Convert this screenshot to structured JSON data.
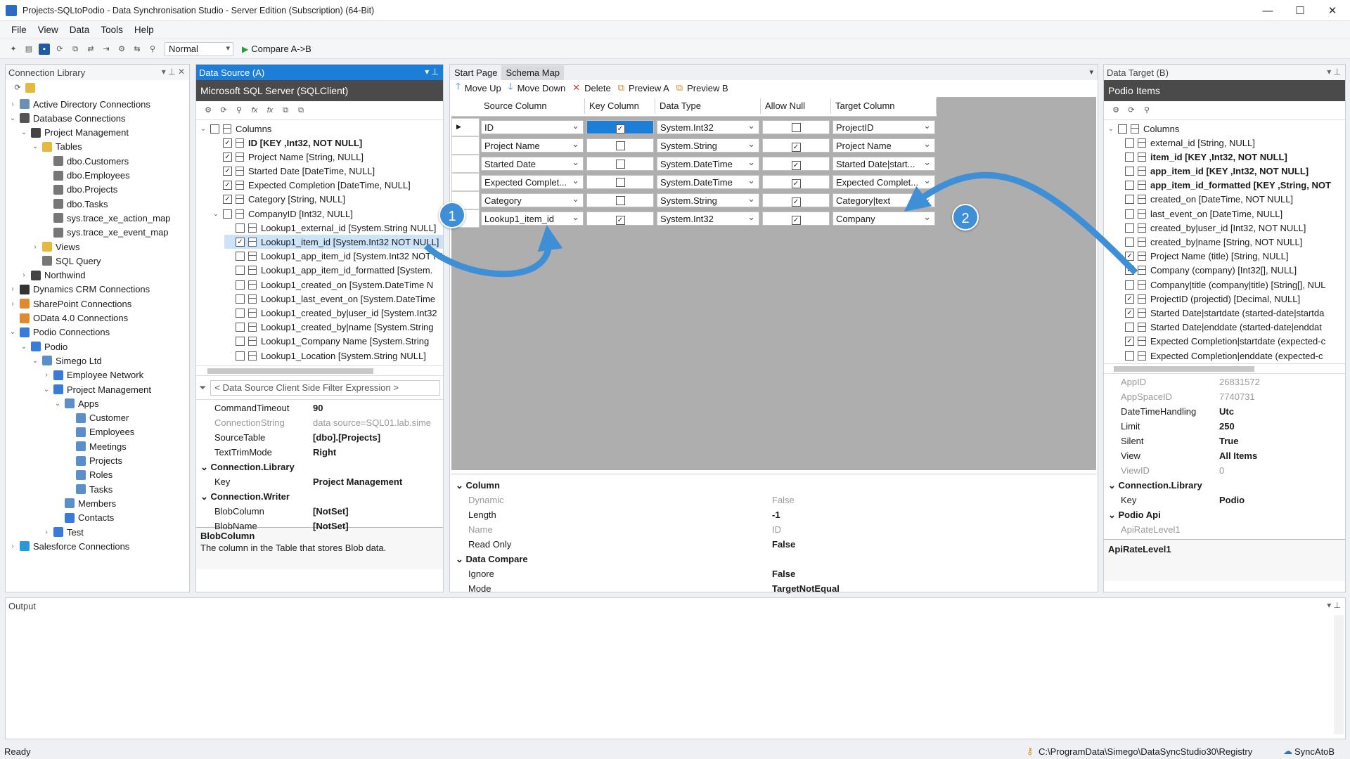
{
  "window": {
    "title": "Projects-SQLtoPodio - Data Synchronisation Studio - Server Edition (Subscription) (64-Bit)"
  },
  "menu": [
    "File",
    "View",
    "Data",
    "Tools",
    "Help"
  ],
  "toolbar": {
    "mode": "Normal",
    "compare": "Compare A->B"
  },
  "connection_library": {
    "title": "Connection Library",
    "items": [
      "Active Directory Connections",
      "Database Connections",
      "Project Management",
      "Tables",
      "dbo.Customers",
      "dbo.Employees",
      "dbo.Projects",
      "dbo.Tasks",
      "sys.trace_xe_action_map",
      "sys.trace_xe_event_map",
      "Views",
      "SQL Query",
      "Northwind",
      "Dynamics CRM Connections",
      "SharePoint Connections",
      "OData 4.0 Connections",
      "Podio Connections",
      "Podio",
      "Simego Ltd",
      "Employee Network",
      "Project Management",
      "Apps",
      "Customer",
      "Employees",
      "Meetings",
      "Projects",
      "Roles",
      "Tasks",
      "Members",
      "Contacts",
      "Test",
      "Salesforce Connections"
    ]
  },
  "source": {
    "title": "Data Source (A)",
    "provider": "Microsoft SQL Server (SQLClient)",
    "columns_label": "Columns",
    "columns": [
      "ID [KEY ,Int32, NOT NULL]",
      "Project Name [String, NULL]",
      "Started Date [DateTime, NULL]",
      "Expected Completion [DateTime, NULL]",
      "Category [String, NULL]",
      "CompanyID [Int32, NULL]",
      "Lookup1_external_id [System.String NULL]",
      "Lookup1_item_id [System.Int32 NOT NULL]",
      "Lookup1_app_item_id [System.Int32 NOT NULL]",
      "Lookup1_app_item_id_formatted [System.",
      "Lookup1_created_on [System.DateTime N",
      "Lookup1_last_event_on [System.DateTime",
      "Lookup1_created_by|user_id [System.Int32",
      "Lookup1_created_by|name [System.String",
      "Lookup1_Company Name [System.String",
      "Lookup1_Location [System.String NULL]"
    ],
    "filter_placeholder": "< Data Source Client Side Filter Expression >",
    "props": [
      [
        "CommandTimeout",
        "90"
      ],
      [
        "ConnectionString",
        "data source=SQL01.lab.sime"
      ],
      [
        "SourceTable",
        "[dbo].[Projects]"
      ],
      [
        "TextTrimMode",
        "Right"
      ]
    ],
    "section1": "Connection.Library",
    "key_label": "Key",
    "key_value": "Project Management",
    "section2": "Connection.Writer",
    "props2": [
      [
        "BlobColumn",
        "[NotSet]"
      ],
      [
        "BlobName",
        "[NotSet]"
      ]
    ],
    "help_title": "BlobColumn",
    "help_text": "The column in the Table that stores Blob data."
  },
  "center": {
    "tabs": [
      "Start Page",
      "Schema Map"
    ],
    "actions": [
      "Move Up",
      "Move Down",
      "Delete",
      "Preview A",
      "Preview B"
    ],
    "headers": [
      "Source Column",
      "Key Column",
      "Data Type",
      "Allow Null",
      "Target Column"
    ],
    "rows": [
      {
        "source": "ID",
        "key": true,
        "type": "System.Int32",
        "null": false,
        "target": "ProjectID"
      },
      {
        "source": "Project Name",
        "key": false,
        "type": "System.String",
        "null": true,
        "target": "Project Name"
      },
      {
        "source": "Started Date",
        "key": false,
        "type": "System.DateTime",
        "null": true,
        "target": "Started Date|start..."
      },
      {
        "source": "Expected Complet...",
        "key": false,
        "type": "System.DateTime",
        "null": true,
        "target": "Expected Complet..."
      },
      {
        "source": "Category",
        "key": false,
        "type": "System.String",
        "null": true,
        "target": "Category|text"
      },
      {
        "source": "Lookup1_item_id",
        "key": true,
        "type": "System.Int32",
        "null": true,
        "target": "Company"
      }
    ],
    "callouts": [
      "1",
      "2"
    ],
    "props_section1": "Column",
    "props1": [
      [
        "Dynamic",
        "False"
      ],
      [
        "Length",
        "-1"
      ],
      [
        "Name",
        "ID"
      ],
      [
        "Read Only",
        "False"
      ]
    ],
    "props_section2": "Data Compare",
    "props2": [
      [
        "Ignore",
        "False"
      ],
      [
        "Mode",
        "TargetNotEqual"
      ]
    ]
  },
  "target": {
    "title": "Data Target (B)",
    "provider": "Podio Items",
    "columns_label": "Columns",
    "columns": [
      "external_id [String, NULL]",
      "item_id [KEY ,Int32, NOT NULL]",
      "app_item_id [KEY ,Int32, NOT NULL]",
      "app_item_id_formatted [KEY ,String, NOT",
      "created_on [DateTime, NOT NULL]",
      "last_event_on [DateTime, NULL]",
      "created_by|user_id [Int32, NOT NULL]",
      "created_by|name [String, NOT NULL]",
      "Project Name (title) [String, NULL]",
      "Company (company) [Int32[], NULL]",
      "Company|title (company|title) [String[], NUL",
      "ProjectID (projectid) [Decimal, NULL]",
      "Started Date|startdate (started-date|startda",
      "Started Date|enddate (started-date|enddat",
      "Expected Completion|startdate (expected-c",
      "Expected Completion|enddate (expected-c"
    ],
    "props": [
      [
        "AppID",
        "26831572"
      ],
      [
        "AppSpaceID",
        "7740731"
      ],
      [
        "DateTimeHandling",
        "Utc"
      ],
      [
        "Limit",
        "250"
      ],
      [
        "Silent",
        "True"
      ],
      [
        "View",
        "All Items"
      ],
      [
        "ViewID",
        "0"
      ]
    ],
    "section1": "Connection.Library",
    "key_label": "Key",
    "key_value": "Podio",
    "section2": "Podio Api",
    "api_prop": "ApiRateLevel1",
    "help_title": "ApiRateLevel1"
  },
  "output": {
    "title": "Output"
  },
  "status": {
    "left": "Ready",
    "path": "C:\\ProgramData\\Simego\\DataSyncStudio30\\Registry",
    "sync": "SyncAtoB"
  }
}
